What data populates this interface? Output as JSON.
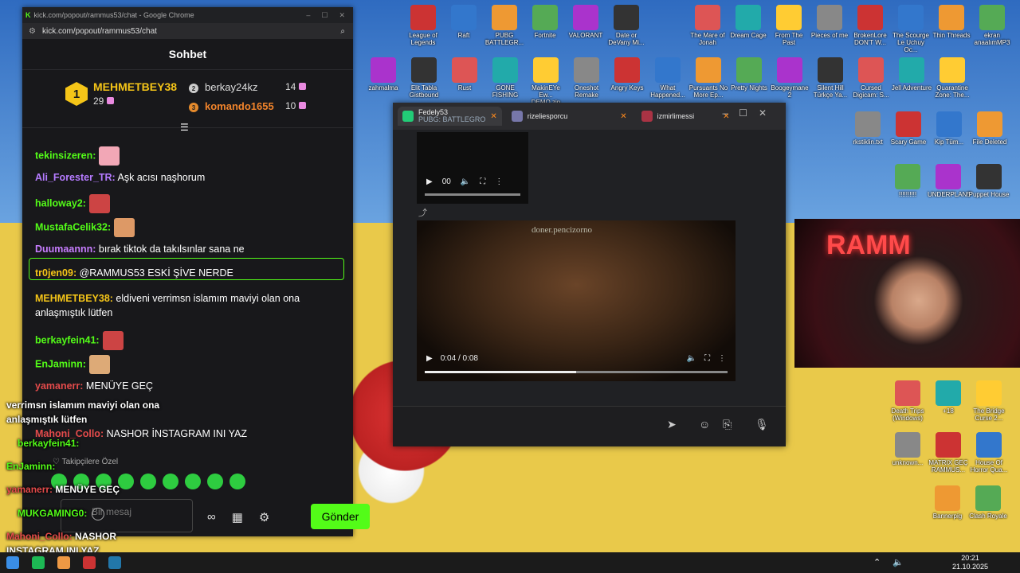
{
  "chat_window": {
    "tab_title": "kick.com/popout/rammus53/chat - Google Chrome",
    "url": "kick.com/popout/rammus53/chat",
    "title": "Sohbet",
    "leaderboard": {
      "first": {
        "rank": "1",
        "name": "MEHMETBEY38",
        "score": "29"
      },
      "second": {
        "rank": "2",
        "name": "berkay24kz",
        "score": "14"
      },
      "third": {
        "rank": "3",
        "name": "komando1655",
        "score": "10"
      }
    },
    "messages": [
      {
        "user": "tekinsizeren:",
        "text": "",
        "color": "#53fc18"
      },
      {
        "user": "Ali_Forester_TR:",
        "text": " Aşk acısı naşhorum",
        "color": "#b57bff"
      },
      {
        "user": "halloway2:",
        "text": "",
        "color": "#53fc18"
      },
      {
        "user": "MustafaCelik32:",
        "text": "",
        "color": "#53fc18"
      },
      {
        "user": "Duumaannn:",
        "text": " bırak tiktok da takılsınlar sana ne",
        "color": "#c77dff"
      },
      {
        "user": "tr0jen09:",
        "text": " @RAMMUS53 ESKİ ŞİVE NERDE",
        "color": "#f5c518"
      },
      {
        "user": "MEHMETBEY38:",
        "text": " eldiveni verrimsn islamım maviyi olan ona anlaşmıştık lütfen",
        "color": "#f5c518"
      },
      {
        "user": "berkayfein41:",
        "text": "",
        "color": "#53fc18"
      },
      {
        "user": "EnJaminn:",
        "text": "",
        "color": "#53fc18"
      },
      {
        "user": "yamanerr:",
        "text": " MENÜYE GEÇ",
        "color": "#e54b4b"
      },
      {
        "user": "Mahoni_Collo:",
        "text": " NASHOR İNSTAGRAM INI YAZ",
        "color": "#e54b4b"
      }
    ],
    "follow_note": "Takipçilere Özel",
    "input_placeholder": "Bir mesaj",
    "send_label": "Gönder"
  },
  "overlay_chat": {
    "line1": "verrimsn islamım maviyi olan ona",
    "line2": "anlaşmıştık lütfen",
    "line3": "berkayfein41:",
    "line4": "EnJaminn:",
    "line5_user": "yamanerr:",
    "line5_text": " MENÜYE GEÇ",
    "line6": "MUKGAMING0:",
    "line7_user": "Mahoni_Collo:",
    "line7_text": " NASHOR",
    "line8": "INSTAGRAM INI YAZ"
  },
  "browser_window": {
    "tabs": [
      {
        "label": "Fedely53",
        "sublabel": "PUBG: BATTLEGRO"
      },
      {
        "label": "rizeliesporcu"
      },
      {
        "label": "izmirlimessi"
      }
    ],
    "small_video_time": "00",
    "big_video": {
      "watermark": "doner.pencizorno",
      "time": "0:04 / 0:08",
      "progress": 0.5
    }
  },
  "desktop_icons": [
    "League of Legends",
    "Raft",
    "PUBG BATTLEGR...",
    "Fortnite",
    "VALORANT",
    "Date or DeVany Mi...",
    "The Mare of Jonah",
    "Dream Cage",
    "From The Past",
    "Pieces of me",
    "BrokenLore DON'T W...",
    "The Scourge Le Uchuy Oc...",
    "Thin Threads",
    "ekran anaalımMP3",
    "zahmalma",
    "Elit Tabla Gistbound",
    "Rust",
    "GONE FISHING",
    "MakinEYe Ew... DEMO.zip",
    "Oneshot Remake",
    "Angry Keys",
    "What Happened...",
    "Pursuants No More Ep...",
    "Pretty Nights",
    "Boogeymane 2",
    "Silent Hill Türkçe Ya...",
    "Cursed Digicam: S...",
    "Jell Adventure",
    "Quarantine Zone: The...",
    "rkstiklin.txt",
    "Scary Game",
    "Kip Tüm...",
    "File Deleted",
    "!!!!!!!!!!",
    "UNDERPLAN5",
    "Puppet House",
    "Death Trips (Windows)",
    "+18",
    "The Bridge Curse 2...",
    "unknown...",
    "MATRIX GEÇ RAMMUS...",
    "House Of Horror Qua...",
    "Bannerpig",
    "Clash Royale"
  ],
  "taskbar": {
    "time": "20:21",
    "date": "21.10.2025"
  }
}
